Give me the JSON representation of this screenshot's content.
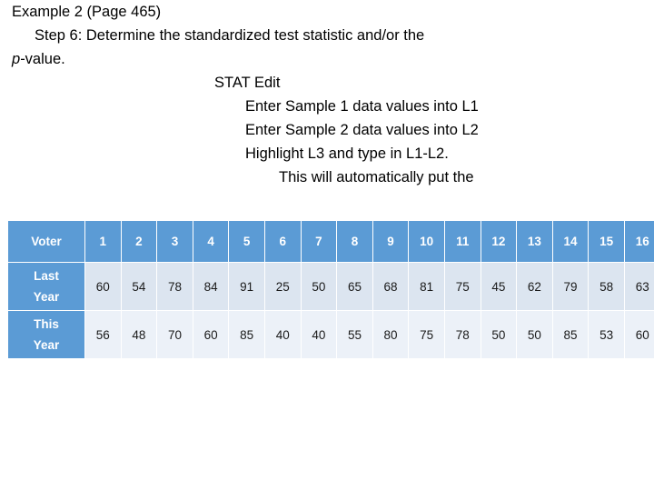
{
  "slide": {
    "lines": [
      {
        "text": "Example 2 (Page 465)",
        "indent": 0,
        "italic_prefix": ""
      },
      {
        "text": "Step 6: Determine the standardized test statistic and/or the",
        "indent": 1,
        "italic_prefix": ""
      },
      {
        "text": "-value.",
        "indent": 0,
        "italic_prefix": "p"
      },
      {
        "text": "STAT Edit",
        "indent": 2,
        "italic_prefix": ""
      },
      {
        "text": "Enter Sample 1 data values into L1",
        "indent": 3,
        "italic_prefix": ""
      },
      {
        "text": "Enter Sample 2 data values into L2",
        "indent": 3,
        "italic_prefix": ""
      },
      {
        "text": "Highlight L3 and type in L1-L2.",
        "indent": 3,
        "italic_prefix": ""
      },
      {
        "text": "This will automatically put the",
        "indent": 4,
        "italic_prefix": ""
      }
    ],
    "line_0": "Example 2 (Page 465)",
    "line_1": "Step 6: Determine the standardized test statistic and/or the",
    "line_2_italic": "p",
    "line_2_rest": "-value.",
    "line_3": "STAT Edit",
    "line_4": "Enter Sample 1 data values into L1",
    "line_5": "Enter Sample 2 data values into L2",
    "line_6": "Highlight L3 and type in L1-L2.",
    "line_7": "This will automatically put the"
  },
  "table": {
    "header_label": "Voter",
    "columns": [
      "1",
      "2",
      "3",
      "4",
      "5",
      "6",
      "7",
      "8",
      "9",
      "10",
      "11",
      "12",
      "13",
      "14",
      "15",
      "16"
    ],
    "rows": [
      {
        "label_line1": "Last",
        "label_line2": "Year",
        "values": [
          60,
          54,
          78,
          84,
          91,
          25,
          50,
          65,
          68,
          81,
          75,
          45,
          62,
          79,
          58,
          63
        ]
      },
      {
        "label_line1": "This",
        "label_line2": "Year",
        "values": [
          56,
          48,
          70,
          60,
          85,
          40,
          40,
          55,
          80,
          75,
          78,
          50,
          50,
          85,
          53,
          60
        ]
      }
    ],
    "colors": {
      "header_blue": "#5B9BD5",
      "band_a": "#DCE5F0",
      "band_b": "#ECF1F8",
      "header_text": "#FFFFFF",
      "cell_text": "#1A1A1A"
    }
  }
}
